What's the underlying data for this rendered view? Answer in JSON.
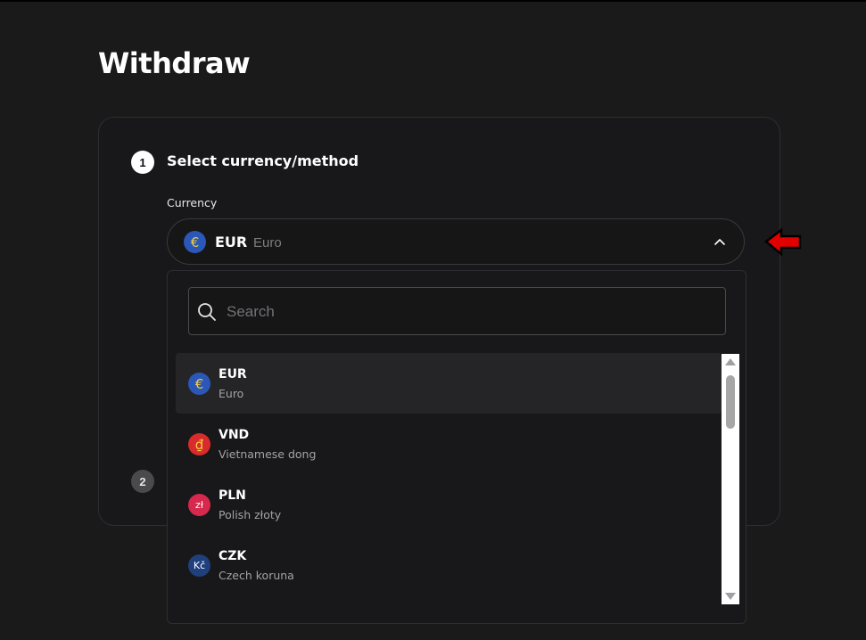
{
  "page": {
    "title": "Withdraw"
  },
  "steps": [
    {
      "number": "1",
      "title": "Select currency/method"
    },
    {
      "number": "2"
    }
  ],
  "currency_field": {
    "label": "Currency",
    "selected": {
      "code": "EUR",
      "name": "Euro",
      "symbol": "€"
    }
  },
  "search": {
    "placeholder": "Search",
    "value": ""
  },
  "currencies": [
    {
      "code": "EUR",
      "name": "Euro",
      "symbol": "€",
      "color": "#2b57b8"
    },
    {
      "code": "VND",
      "name": "Vietnamese dong",
      "symbol": "₫",
      "color": "#d92b2b"
    },
    {
      "code": "PLN",
      "name": "Polish złoty",
      "symbol": "zł",
      "color": "#d6294d"
    },
    {
      "code": "CZK",
      "name": "Czech koruna",
      "symbol": "Kč",
      "color": "#1f3f7d"
    }
  ],
  "colors": {
    "background": "#1a1a1b",
    "card_border": "#2e2e30",
    "annotation_arrow": "#e00000"
  },
  "icons": {
    "search": "search-icon",
    "chevron": "chevron-up-icon",
    "annotation": "red-arrow-icon"
  }
}
